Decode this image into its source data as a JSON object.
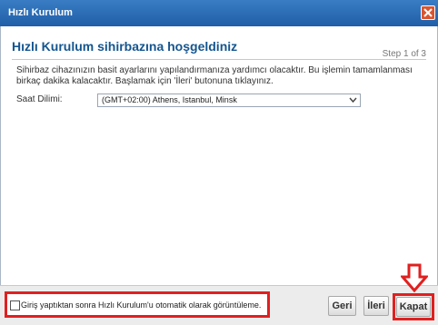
{
  "window": {
    "title": "Hızlı Kurulum",
    "close_icon": "close-icon"
  },
  "wizard": {
    "heading": "Hızlı Kurulum sihirbazına hoşgeldiniz",
    "step": "Step 1 of 3",
    "description": "Sihirbaz cihazınızın basit ayarlarını yapılandırmanıza yardımcı olacaktır. Bu işlemin tamamlanması birkaç dakika kalacaktır. Başlamak için 'İleri' butonuna tıklayınız.",
    "timezone_label": "Saat Dilimi:",
    "timezone_value": "(GMT+02:00) Athens, Istanbul, Minsk"
  },
  "footer": {
    "auto_hide_label": "Giriş yaptıktan sonra Hızlı Kurulum'u otomatik olarak görüntüleme.",
    "back_label": "Geri",
    "next_label": "İleri",
    "close_label": "Kapat"
  },
  "colors": {
    "titlebar": "#2a6bb5",
    "heading": "#14558f",
    "highlight": "#e02020"
  }
}
